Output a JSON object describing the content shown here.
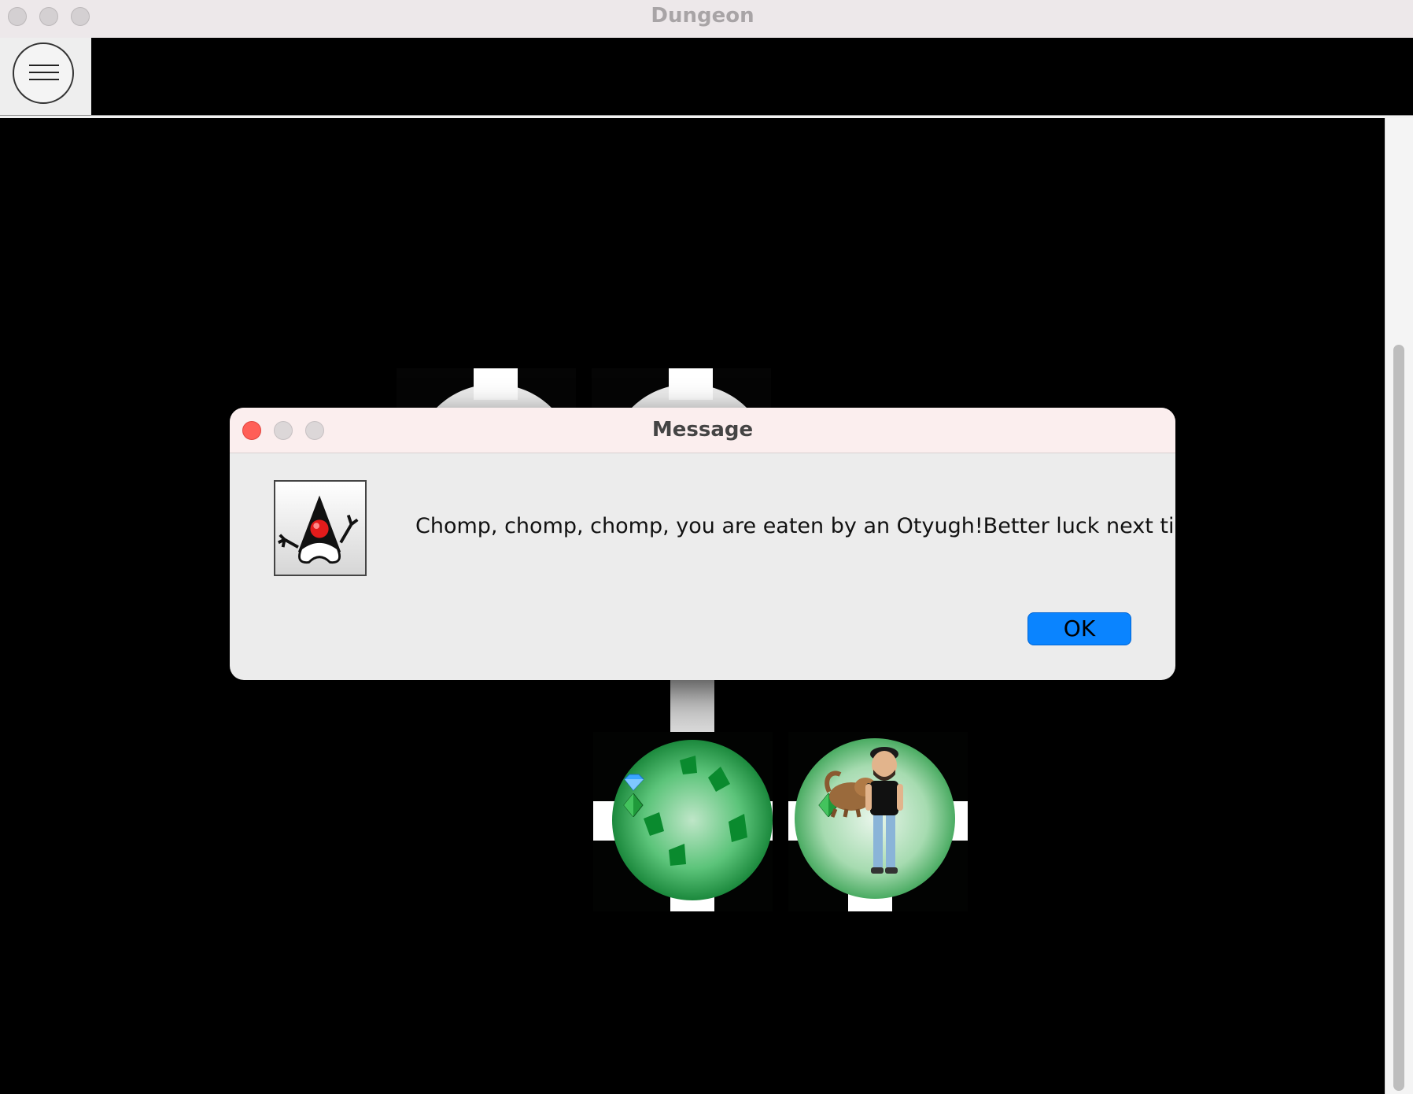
{
  "window": {
    "title": "Dungeon",
    "traffic_lights": [
      "close",
      "minimize",
      "zoom"
    ]
  },
  "toolbar": {
    "menu_icon": "hamburger-menu-icon"
  },
  "dungeon": {
    "background": "#000000",
    "rooms": [
      {
        "id": "room-top-left",
        "partially_hidden": true,
        "items": []
      },
      {
        "id": "room-top-right",
        "partially_hidden": true,
        "items": []
      },
      {
        "id": "room-bottom-left",
        "items": [
          "blue-gem-icon",
          "green-gem-icon"
        ]
      },
      {
        "id": "room-bottom-right",
        "items": [
          "green-gem-icon",
          "otyugh-monster-icon",
          "player-avatar-icon"
        ]
      }
    ]
  },
  "dialog": {
    "title": "Message",
    "icon": "java-duke-icon",
    "message": "Chomp, chomp, chomp, you are eaten by an Otyugh!Better luck next time",
    "ok_label": "OK",
    "colors": {
      "close": "#ff5f57",
      "ok_button": "#0a84ff"
    }
  }
}
